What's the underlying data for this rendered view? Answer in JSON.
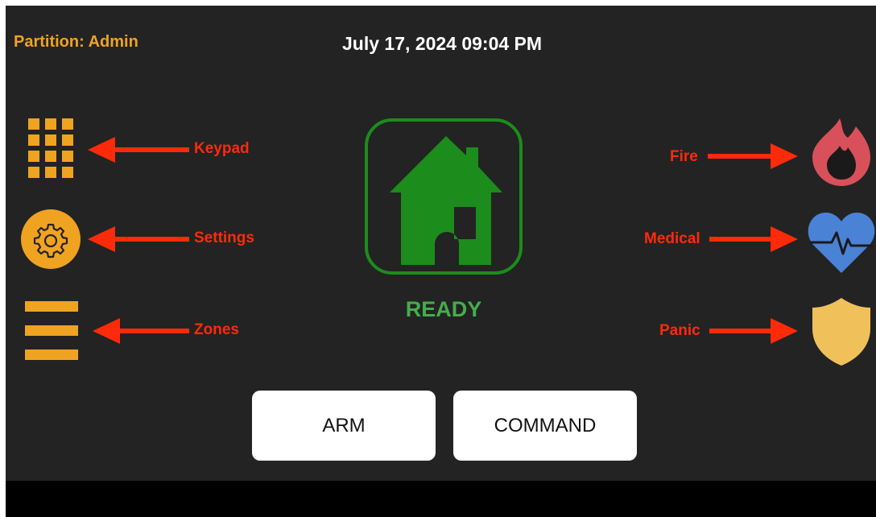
{
  "header": {
    "partition": "Partition: Admin",
    "datetime": "July 17, 2024 09:04 PM"
  },
  "left_actions": [
    {
      "label": "Keypad",
      "icon": "keypad-grid-icon"
    },
    {
      "label": "Settings",
      "icon": "gear-icon"
    },
    {
      "label": "Zones",
      "icon": "zones-list-icon"
    }
  ],
  "right_actions": [
    {
      "label": "Fire",
      "icon": "fire-icon"
    },
    {
      "label": "Medical",
      "icon": "heart-pulse-icon"
    },
    {
      "label": "Panic",
      "icon": "shield-icon"
    }
  ],
  "status": {
    "text": "READY",
    "icon": "house-icon"
  },
  "buttons": {
    "arm": "ARM",
    "command": "COMMAND"
  },
  "colors": {
    "background": "#232323",
    "accent_orange": "#f0a320",
    "annotation_red": "#ff2a0a",
    "ready_green": "#45ad4b",
    "fire": "#d8505a",
    "medical": "#4a82d6",
    "panic": "#f0c15a"
  }
}
